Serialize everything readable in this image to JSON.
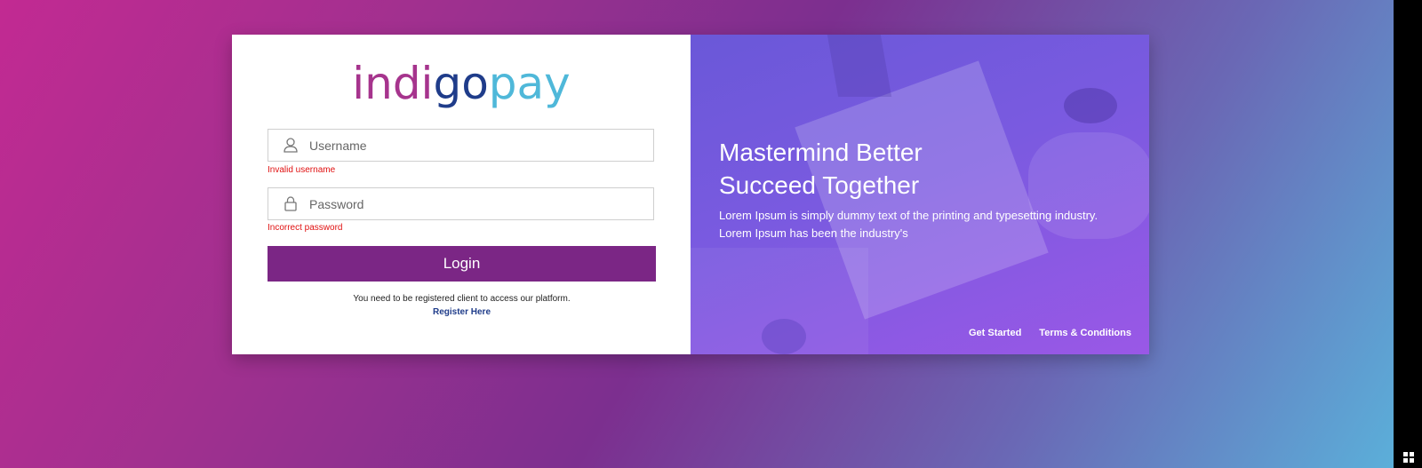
{
  "logo": {
    "part1": "indi",
    "part2": "go",
    "part3": "pay"
  },
  "login_form": {
    "username_placeholder": "Username",
    "username_value": "",
    "username_error": "Invalid username",
    "password_placeholder": "Password",
    "password_value": "",
    "password_error": "Incorrect password",
    "login_label": "Login",
    "note": "You need to be registered client to access our platform.",
    "register_label": "Register Here"
  },
  "hero": {
    "headline_line1": "Mastermind Better",
    "headline_line2": "Succeed Together",
    "subtext_line1": "Lorem Ipsum is simply dummy text of the printing and typesetting industry.",
    "subtext_line2": "Lorem Ipsum has been the industry's",
    "links": [
      "Get Started",
      "Terms & Conditions"
    ]
  },
  "colors": {
    "brand_purple": "#7b2685",
    "error_red": "#e01010",
    "link_blue": "#1f3c8a"
  }
}
